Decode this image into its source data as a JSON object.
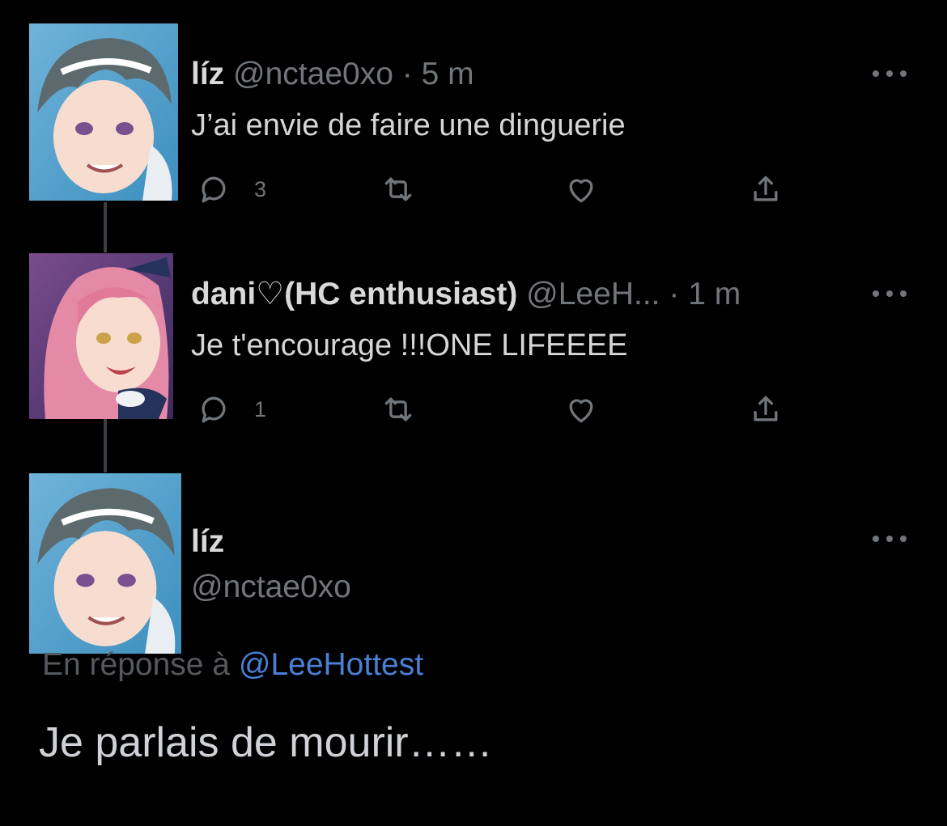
{
  "colors": {
    "background": "#000000",
    "primary_text": "#e7e9ea",
    "secondary_text": "#71767b",
    "link": "#4a7fd6",
    "thread_line": "#3b3e42"
  },
  "tweets": [
    {
      "display_name": "líz",
      "handle": "@nctae0xo",
      "separator": "·",
      "time": "5 m",
      "text": "J’ai envie de faire une dinguerie",
      "avatar_icon": "anime-avatar-dark-hair",
      "actions": {
        "reply_icon": "reply-icon",
        "reply_count": "3",
        "retweet_icon": "retweet-icon",
        "like_icon": "heart-icon",
        "share_icon": "share-icon"
      }
    },
    {
      "display_name": "dani♡(HC enthusiast)",
      "handle": "@LeeH...",
      "separator": "·",
      "time": "1 m",
      "text": "Je t'encourage !!!ONE LIFEEEE",
      "avatar_icon": "anime-avatar-pink-hair",
      "actions": {
        "reply_icon": "reply-icon",
        "reply_count": "1",
        "retweet_icon": "retweet-icon",
        "like_icon": "heart-icon",
        "share_icon": "share-icon"
      }
    }
  ],
  "focused_tweet": {
    "display_name": "líz",
    "handle": "@nctae0xo",
    "avatar_icon": "anime-avatar-dark-hair",
    "reply_prefix": "En réponse à",
    "reply_mention": "@LeeHottest",
    "text": "Je parlais de mourir……"
  }
}
